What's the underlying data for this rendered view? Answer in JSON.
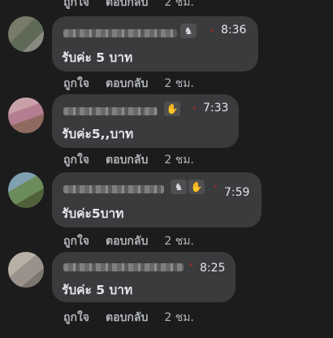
{
  "action_labels": {
    "like": "ถูกใจ",
    "reply": "ตอบกลับ"
  },
  "top_actions": {
    "time": "2 ชม."
  },
  "comments": [
    {
      "time": "8:36",
      "text": "รับค่ะ 5 บาท",
      "badges": [
        "contributor-icon"
      ],
      "action_time": "2 ชม."
    },
    {
      "time": "7:33",
      "text": "รับค่ะ5,,บาท",
      "badges": [
        "wave-icon"
      ],
      "action_time": "2 ชม."
    },
    {
      "time": "7:59",
      "text": "รับค่ะ5บาท",
      "badges": [
        "contributor-icon",
        "wave-icon"
      ],
      "action_time": "2 ชม."
    },
    {
      "time": "8:25",
      "text": "รับค่ะ 5 บาท",
      "badges": [],
      "action_time": "2 ชม."
    }
  ]
}
